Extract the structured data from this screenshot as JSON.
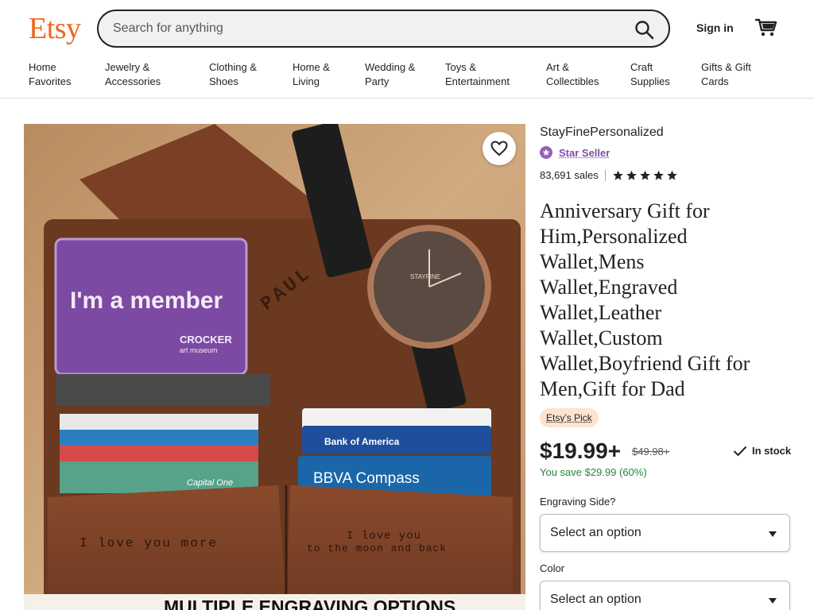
{
  "header": {
    "logo": "Etsy",
    "search_placeholder": "Search for anything",
    "signin_label": "Sign in",
    "icons": {
      "search": "search-icon",
      "cart": "cart-icon"
    }
  },
  "nav": {
    "items": [
      "Home\nFavorites",
      "Jewelry &\nAccessories",
      "Clothing &\nShoes",
      "Home &\nLiving",
      "Wedding &\nParty",
      "Toys &\nEntertainment",
      "Art &\nCollectibles",
      "Craft\nSupplies",
      "Gifts & Gift\nCards"
    ]
  },
  "photo": {
    "card_text": "I'm a member",
    "card_brand": "CROCKER",
    "card_brand_sub": "art museum",
    "wallet_name": "PAUL",
    "card_bank1": "Bank of America",
    "card_bank2": "BBVA Compass",
    "card_bank3": "Capital One",
    "engraving_left": "I love you more",
    "engraving_right_1": "I love you",
    "engraving_right_2": "to the moon and back",
    "caption": "MULTIPLE ENGRAVING OPTIONS",
    "watch_brand": "STAYFINE"
  },
  "listing": {
    "shop_name": "StayFinePersonalized",
    "star_seller": "Star Seller",
    "sales": "83,691 sales",
    "rating_stars": 5,
    "title": "Anniversary Gift for Him,Personalized Wallet,Mens Wallet,Engraved Wallet,Leather Wallet,Custom Wallet,Boyfriend Gift for Men,Gift for Dad",
    "etsys_pick": "Etsy’s Pick",
    "price": "$19.99+",
    "original_price": "$49.98+",
    "stock": "In stock",
    "savings": "You save $29.99 (60%)",
    "options": [
      {
        "label": "Engraving Side?",
        "value": "Select an option"
      },
      {
        "label": "Color",
        "value": "Select an option"
      }
    ]
  },
  "colors": {
    "brand": "#f1641e",
    "star_seller": "#7d4ea8",
    "savings": "#258635"
  }
}
